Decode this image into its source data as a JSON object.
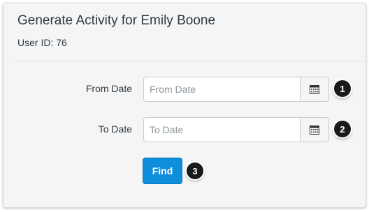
{
  "header": {
    "title": "Generate Activity for Emily Boone",
    "user_id": "User ID: 76"
  },
  "form": {
    "from_label": "From Date",
    "from_placeholder": "From Date",
    "to_label": "To Date",
    "to_placeholder": "To Date",
    "find_label": "Find"
  },
  "callouts": [
    "1",
    "2",
    "3"
  ],
  "colors": {
    "accent": "#0f8fdb",
    "badge": "#1a1a1a",
    "panel": "#f5f5f5"
  }
}
